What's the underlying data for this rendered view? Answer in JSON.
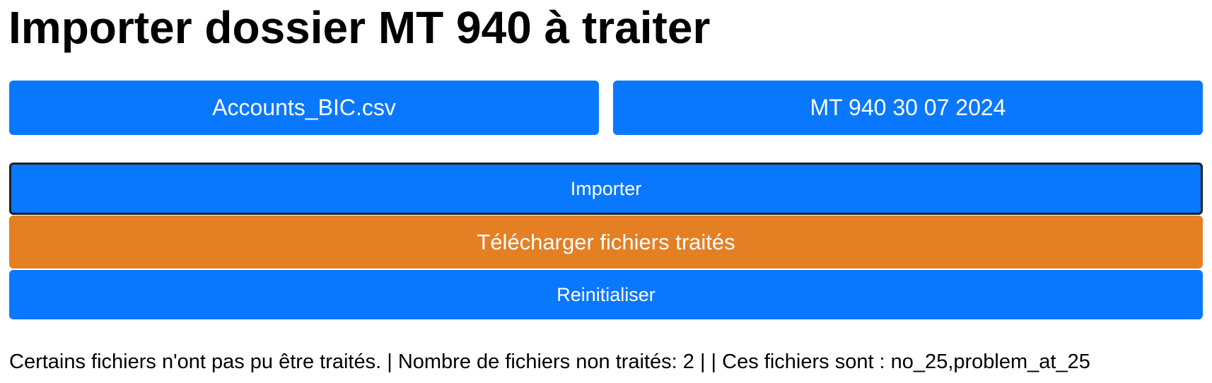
{
  "page": {
    "title": "Importer dossier MT 940 à traiter"
  },
  "files": {
    "accounts_file_label": "Accounts_BIC.csv",
    "folder_label": "MT 940 30 07 2024"
  },
  "actions": {
    "import_label": "Importer",
    "download_label": "Télécharger fichiers traités",
    "reset_label": "Reinitialiser"
  },
  "status": {
    "message": "Certains fichiers n'ont pas pu être traités. | Nombre de fichiers non traités: 2 | | Ces fichiers sont : no_25,problem_at_25"
  },
  "colors": {
    "primary": "#0a78fe",
    "download": "#e47f24",
    "focus_border": "#1b1f25"
  }
}
